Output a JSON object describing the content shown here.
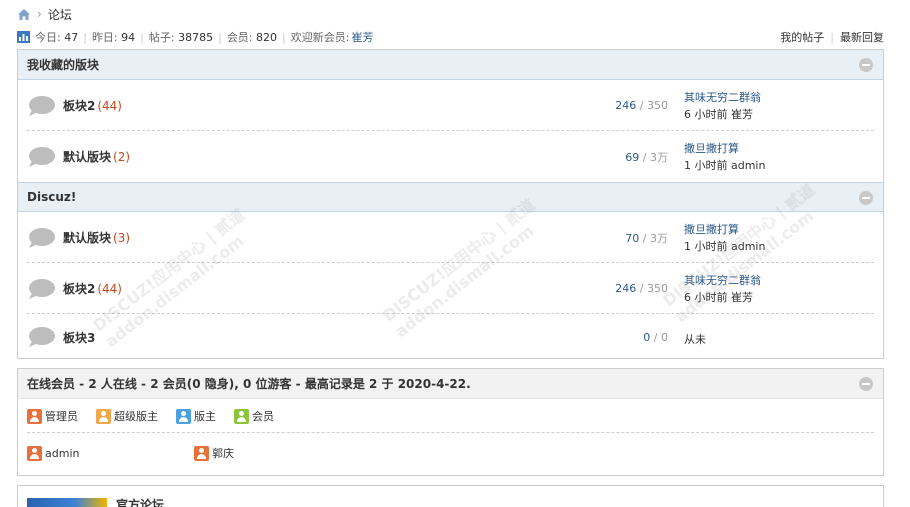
{
  "breadcrumb": {
    "home_icon": "home-icon",
    "current": "论坛"
  },
  "stats": {
    "today_label": "今日:",
    "today": "47",
    "yesterday_label": "昨日:",
    "yesterday": "94",
    "posts_label": "帖子:",
    "posts": "38785",
    "members_label": "会员:",
    "members": "820",
    "welcome_label": "欢迎新会员:",
    "newest_member": "崔芳",
    "my_posts": "我的帖子",
    "latest_replies": "最新回复"
  },
  "categories": [
    {
      "title": "我收藏的版块",
      "forums": [
        {
          "name": "板块2",
          "count": "(44)",
          "threads": "246",
          "posts": "350",
          "last_title": "其味无穷二群翁",
          "last_meta": "6 小时前 崔芳"
        },
        {
          "name": "默认版块",
          "count": "(2)",
          "threads": "69",
          "posts": "3万",
          "last_title": "撒旦撒打算",
          "last_meta": "1 小时前 admin"
        }
      ]
    },
    {
      "title": "Discuz!",
      "forums": [
        {
          "name": "默认版块",
          "count": "(3)",
          "threads": "70",
          "posts": "3万",
          "last_title": "撒旦撒打算",
          "last_meta": "1 小时前 admin"
        },
        {
          "name": "板块2",
          "count": "(44)",
          "threads": "246",
          "posts": "350",
          "last_title": "其味无穷二群翁",
          "last_meta": "6 小时前 崔芳"
        },
        {
          "name": "板块3",
          "count": "",
          "threads": "0",
          "posts": "0",
          "last_never": "从未"
        }
      ]
    }
  ],
  "online": {
    "title": "在线会员 - 2 人在线 - 2 会员(0 隐身), 0 位游客 - 最高记录是 2 于 2020-4-22.",
    "legend": [
      {
        "label": "管理员",
        "color": "#e8703a"
      },
      {
        "label": "超级版主",
        "color": "#f0a94a"
      },
      {
        "label": "版主",
        "color": "#4aa3e0"
      },
      {
        "label": "会员",
        "color": "#8cc43c"
      }
    ],
    "users": [
      {
        "name": "admin",
        "color": "#e8703a"
      },
      {
        "name": "郭庆",
        "color": "#e8703a"
      }
    ]
  },
  "links": {
    "title": "官方论坛"
  },
  "watermark": {
    "line1": "DISCUZ!应用中心 | 贰道",
    "line2": "addon.dismall.com"
  },
  "colors": {
    "accent": "#2b5a8a",
    "count": "#c7491f",
    "header_bg": "#e8eff5"
  }
}
